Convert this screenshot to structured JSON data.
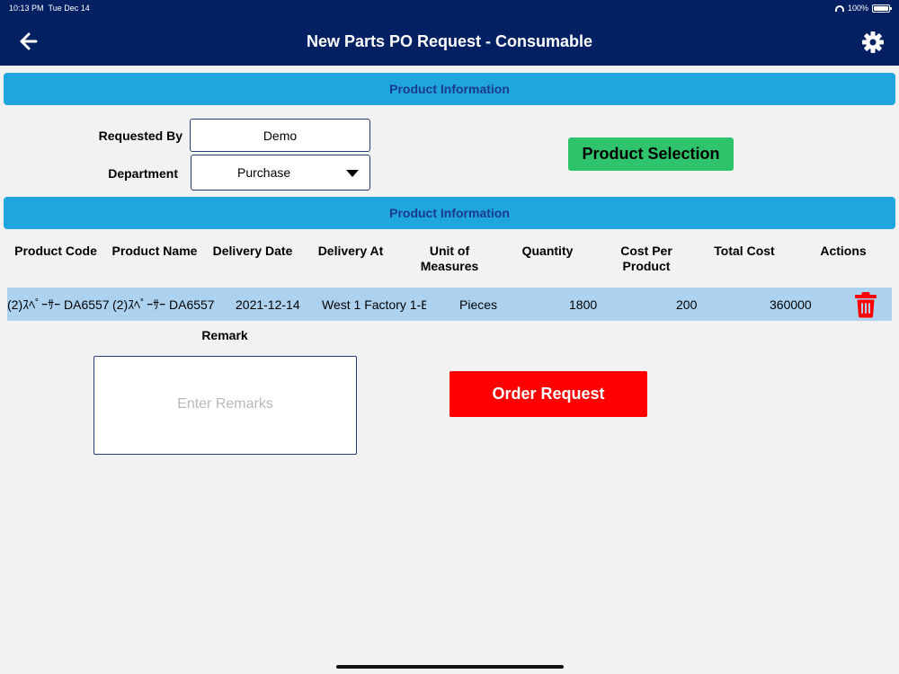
{
  "status_bar": {
    "time": "10:13 PM",
    "date": "Tue Dec 14",
    "battery": "100%"
  },
  "nav": {
    "title": "New Parts PO Request - Consumable"
  },
  "section1": {
    "title": "Product Information"
  },
  "form": {
    "requested_by_label": "Requested By",
    "requested_by_value": "Demo",
    "department_label": "Department",
    "department_value": "Purchase",
    "product_selection_label": "Product Selection"
  },
  "section2": {
    "title": "Product Information"
  },
  "table": {
    "headers": {
      "product_code": "Product Code",
      "product_name": "Product Name",
      "delivery_date": "Delivery Date",
      "delivery_at": "Delivery At",
      "uom_line1": "Unit of",
      "uom_line2": "Measures",
      "quantity": "Quantity",
      "cost_line1": "Cost Per",
      "cost_line2": "Product",
      "total_cost": "Total Cost",
      "actions": "Actions"
    },
    "rows": [
      {
        "product_code": "(2)ｽﾍﾟｰｻｰ DA6557",
        "product_name": "(2)ｽﾍﾟｰｻｰ DA6557",
        "delivery_date": "2021-12-14",
        "delivery_at": "West 1 Factory 1-E",
        "uom": "Pieces",
        "quantity": "1800",
        "cost_per_product": "200",
        "total_cost": "360000"
      }
    ]
  },
  "remark": {
    "label": "Remark",
    "placeholder": "Enter Remarks"
  },
  "order": {
    "label": "Order Request"
  },
  "colors": {
    "nav": "#032063",
    "section": "#1ea6dd",
    "accent_green": "#2ec46b",
    "danger": "#ff0000",
    "row": "#acd2f0"
  },
  "icons": {
    "back": "arrow-left",
    "settings": "gear",
    "delete": "trash"
  }
}
